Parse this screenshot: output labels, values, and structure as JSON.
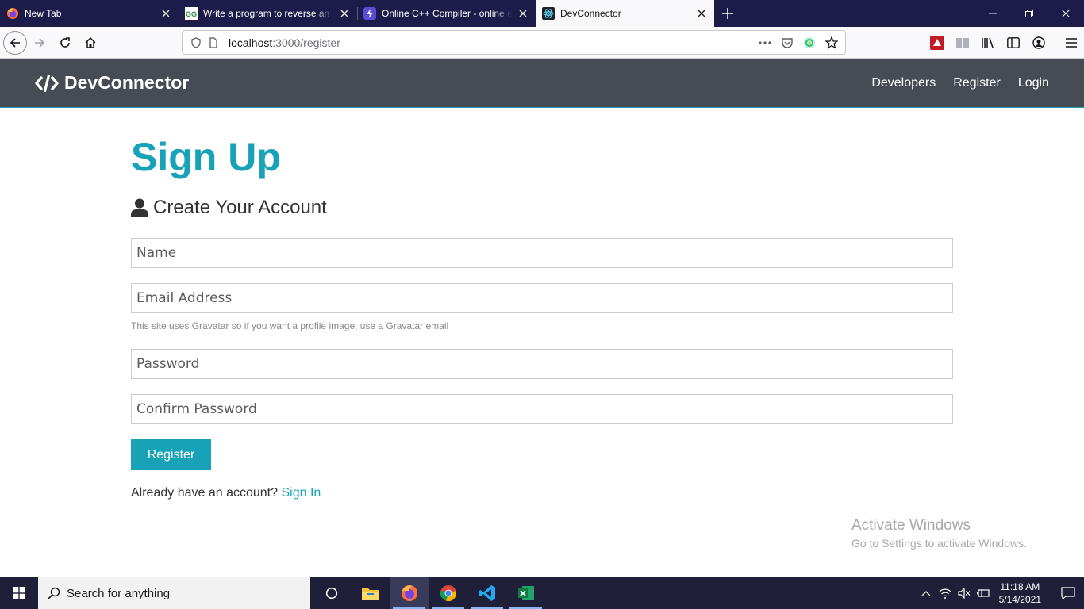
{
  "browser": {
    "tabs": [
      {
        "title": "New Tab",
        "icon": "firefox-icon",
        "active": false
      },
      {
        "title": "Write a program to reverse an array",
        "icon": "geeksforgeeks-icon",
        "active": false
      },
      {
        "title": "Online C++ Compiler - online editor",
        "icon": "lightning-icon",
        "active": false
      },
      {
        "title": "DevConnector",
        "icon": "react-icon",
        "active": true
      }
    ],
    "url_host": "localhost",
    "url_path": ":3000/register"
  },
  "app": {
    "brand": "DevConnector",
    "nav": {
      "developers": "Developers",
      "register": "Register",
      "login": "Login"
    }
  },
  "page": {
    "title": "Sign Up",
    "lead": "Create Your Account",
    "fields": {
      "name_placeholder": "Name",
      "email_placeholder": "Email Address",
      "email_help": "This site uses Gravatar so if you want a profile image, use a Gravatar email",
      "password_placeholder": "Password",
      "confirm_placeholder": "Confirm Password"
    },
    "submit_label": "Register",
    "footnote_text": "Already have an account? ",
    "footnote_link": "Sign In"
  },
  "watermark": {
    "line1": "Activate Windows",
    "line2": "Go to Settings to activate Windows."
  },
  "taskbar": {
    "search_placeholder": "Search for anything",
    "time": "11:18 AM",
    "date": "5/14/2021"
  },
  "colors": {
    "accent": "#17a2b8",
    "nav_bg": "#474c54",
    "tabstrip_bg": "#1c1b4a"
  }
}
